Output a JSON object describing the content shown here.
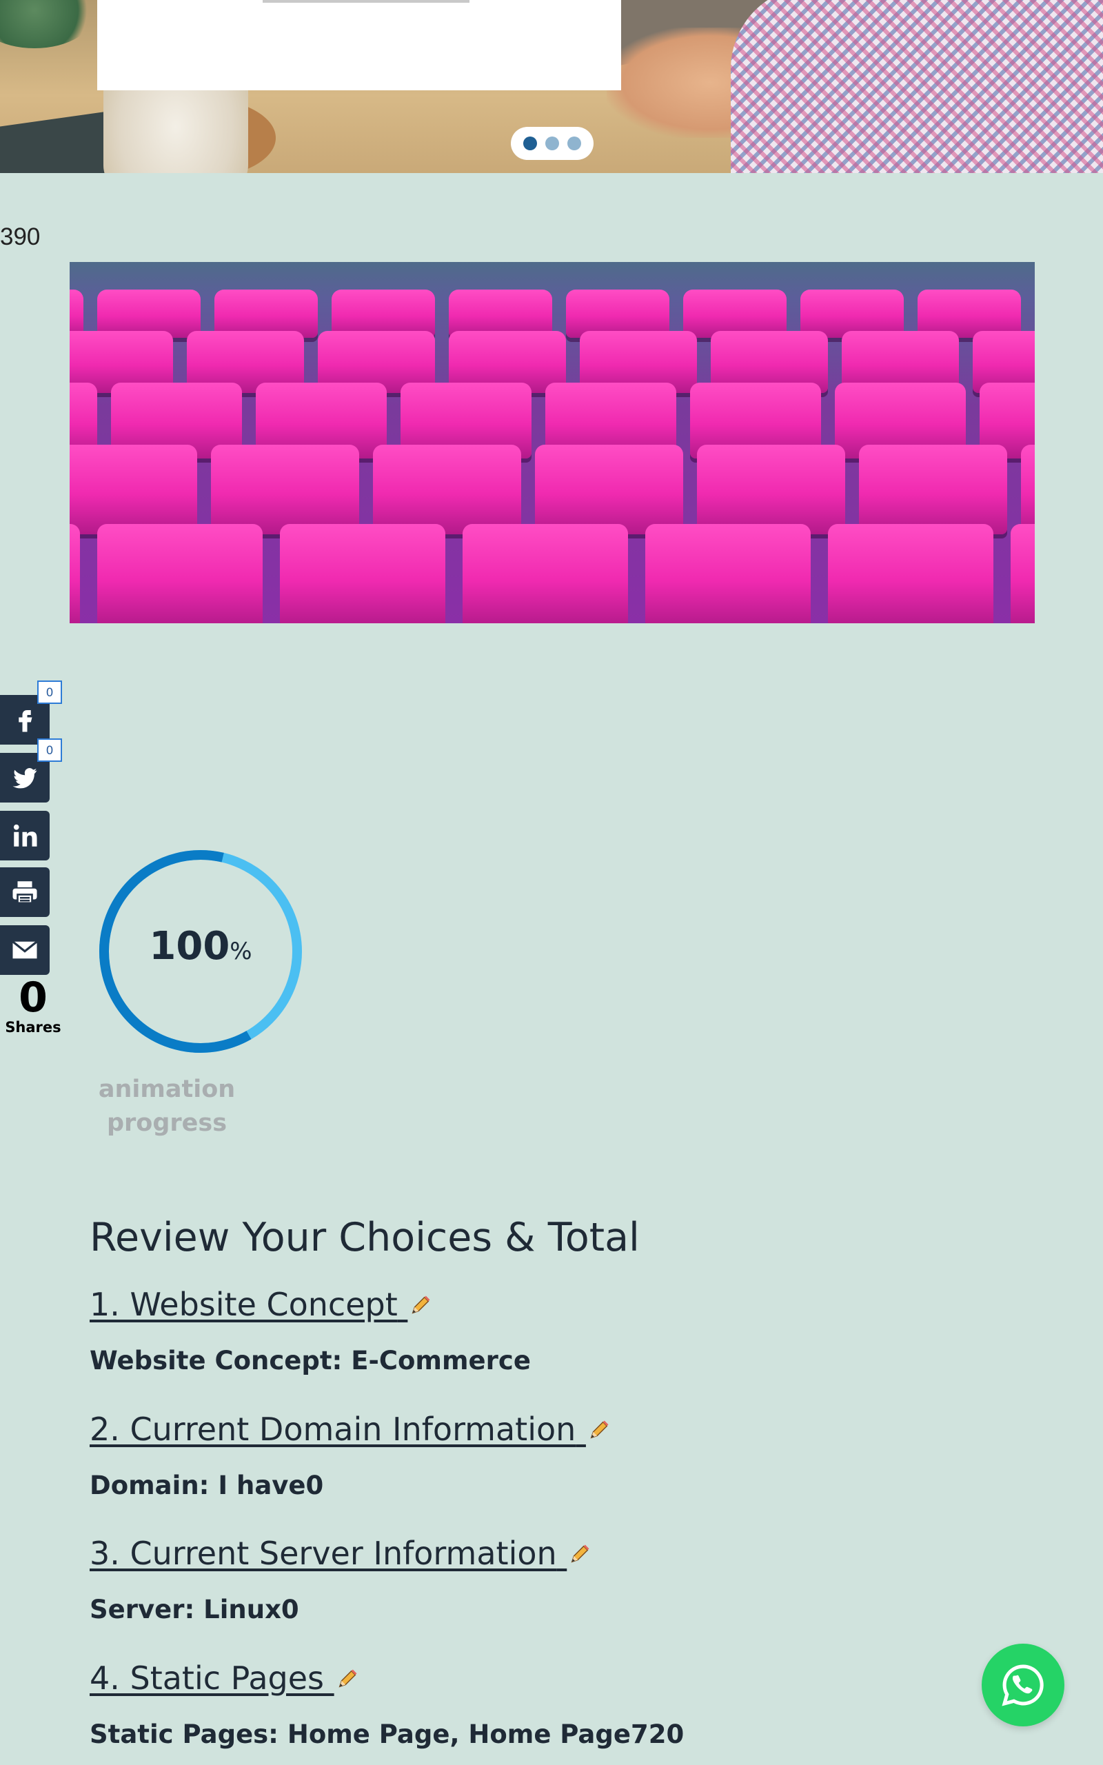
{
  "hero": {
    "slider_dots": [
      {
        "label": "slide 1",
        "active": true
      },
      {
        "label": "slide 2",
        "active": false
      },
      {
        "label": "slide 3",
        "active": false
      }
    ]
  },
  "counter_text": "390",
  "share_bar": {
    "facebook_count": "0",
    "twitter_count": "0",
    "total_shares": "0",
    "shares_label": "Shares"
  },
  "progress": {
    "value": "100",
    "unit": "%",
    "fraction": 1.0,
    "caption_line1": "animation",
    "caption_line2": "progress",
    "colors": {
      "primary": "#0a7cc6",
      "secondary": "#4bbff2"
    }
  },
  "review": {
    "title": "Review Your Choices & Total",
    "steps": [
      {
        "link": "1. Website Concept",
        "value": "Website Concept: E-Commerce"
      },
      {
        "link": "2. Current Domain Information",
        "value": "Domain: I have0"
      },
      {
        "link": "3. Current Server Information",
        "value": "Server: Linux0"
      },
      {
        "link": "4. Static Pages",
        "value": "Static Pages: Home Page, Home Page720"
      }
    ]
  },
  "icons": {
    "facebook": "facebook-icon",
    "twitter": "twitter-icon",
    "linkedin": "linkedin-icon",
    "print": "printer-icon",
    "email": "envelope-icon",
    "edit": "pencil-icon",
    "whatsapp": "whatsapp-icon"
  },
  "colors": {
    "page_background": "#d0e3dd",
    "share_button": "#243447",
    "whatsapp": "#25d366"
  }
}
